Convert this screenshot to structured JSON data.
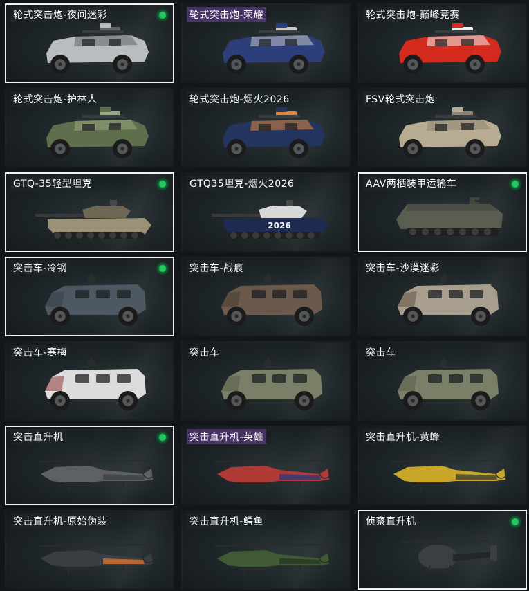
{
  "items": [
    {
      "label": "轮式突击炮-夜间迷彩",
      "selected": true,
      "equipped": true,
      "label_style": "dark",
      "vehicle_type": "wheeled-assault-gun",
      "color": "#b9bdc0",
      "accent": "#5d6468"
    },
    {
      "label": "轮式突击炮-荣耀",
      "selected": false,
      "equipped": false,
      "label_style": "purple",
      "vehicle_type": "wheeled-assault-gun",
      "color": "#2c3f7a",
      "accent": "#c9c9c9"
    },
    {
      "label": "轮式突击炮-巅峰竞赛",
      "selected": false,
      "equipped": false,
      "label_style": "dark",
      "vehicle_type": "wheeled-assault-gun",
      "color": "#d42a1e",
      "accent": "#f1f1f1"
    },
    {
      "label": "轮式突击炮-护林人",
      "selected": false,
      "equipped": false,
      "label_style": "dark",
      "vehicle_type": "wheeled-assault-gun",
      "color": "#5f6e4c",
      "accent": "#9aa882"
    },
    {
      "label": "轮式突击炮-烟火2026",
      "selected": false,
      "equipped": false,
      "label_style": "dark",
      "vehicle_type": "wheeled-assault-gun",
      "color": "#23345f",
      "accent": "#e0863a"
    },
    {
      "label": "FSV轮式突击炮",
      "selected": false,
      "equipped": false,
      "label_style": "dark",
      "vehicle_type": "wheeled-assault-gun",
      "color": "#b7ab92",
      "accent": "#8f8570"
    },
    {
      "label": "GTQ-35轻型坦克",
      "selected": true,
      "equipped": true,
      "label_style": "dark",
      "vehicle_type": "light-tank",
      "color": "#9a9177",
      "accent": "#6e6754"
    },
    {
      "label": "GTQ35坦克-烟火2026",
      "selected": false,
      "equipped": false,
      "label_style": "dark",
      "vehicle_type": "light-tank",
      "color": "#1d2a52",
      "accent": "#d8d8d8",
      "decal": "2026"
    },
    {
      "label": "AAV两栖装甲运输车",
      "selected": true,
      "equipped": true,
      "label_style": "dark",
      "vehicle_type": "amphibious-apc",
      "color": "#5a5e50",
      "accent": "#42463a"
    },
    {
      "label": "突击车-冷钢",
      "selected": true,
      "equipped": true,
      "label_style": "dark",
      "vehicle_type": "assault-vehicle",
      "color": "#4e5862",
      "accent": "#383f47"
    },
    {
      "label": "突击车-战痕",
      "selected": false,
      "equipped": false,
      "label_style": "dark",
      "vehicle_type": "assault-vehicle",
      "color": "#6b5a4b",
      "accent": "#4c3f35"
    },
    {
      "label": "突击车-沙漠迷彩",
      "selected": false,
      "equipped": false,
      "label_style": "dark",
      "vehicle_type": "assault-vehicle",
      "color": "#a79e8e",
      "accent": "#6b5a4b"
    },
    {
      "label": "突击车-寒梅",
      "selected": false,
      "equipped": false,
      "label_style": "dark",
      "vehicle_type": "assault-vehicle",
      "color": "#dcdcdc",
      "accent": "#9a4a4a"
    },
    {
      "label": "突击车",
      "selected": false,
      "equipped": false,
      "label_style": "plain",
      "vehicle_type": "assault-vehicle",
      "color": "#7a8068",
      "accent": "#5b6050"
    },
    {
      "label": "突击车",
      "selected": false,
      "equipped": false,
      "label_style": "plain",
      "vehicle_type": "assault-vehicle",
      "color": "#7a8068",
      "accent": "#5b6050"
    },
    {
      "label": "突击直升机",
      "selected": true,
      "equipped": true,
      "label_style": "dark",
      "vehicle_type": "attack-helicopter",
      "color": "#5d6064",
      "accent": "#3d4044"
    },
    {
      "label": "突击直升机-英雄",
      "selected": false,
      "equipped": false,
      "label_style": "purple",
      "vehicle_type": "attack-helicopter",
      "color": "#b03a35",
      "accent": "#2a3a7a"
    },
    {
      "label": "突击直升机-黄蜂",
      "selected": false,
      "equipped": false,
      "label_style": "dark",
      "vehicle_type": "attack-helicopter",
      "color": "#c9a627",
      "accent": "#3a3a3a"
    },
    {
      "label": "突击直升机-原始伪装",
      "selected": false,
      "equipped": false,
      "label_style": "dark",
      "vehicle_type": "attack-helicopter",
      "color": "#3a3d42",
      "accent": "#e0742e"
    },
    {
      "label": "突击直升机-鳄鱼",
      "selected": false,
      "equipped": false,
      "label_style": "dark",
      "vehicle_type": "attack-helicopter",
      "color": "#3f5a34",
      "accent": "#24331e"
    },
    {
      "label": "侦察直升机",
      "selected": true,
      "equipped": true,
      "label_style": "dark",
      "vehicle_type": "scout-helicopter",
      "color": "#3b3e42",
      "accent": "#24272a"
    }
  ]
}
